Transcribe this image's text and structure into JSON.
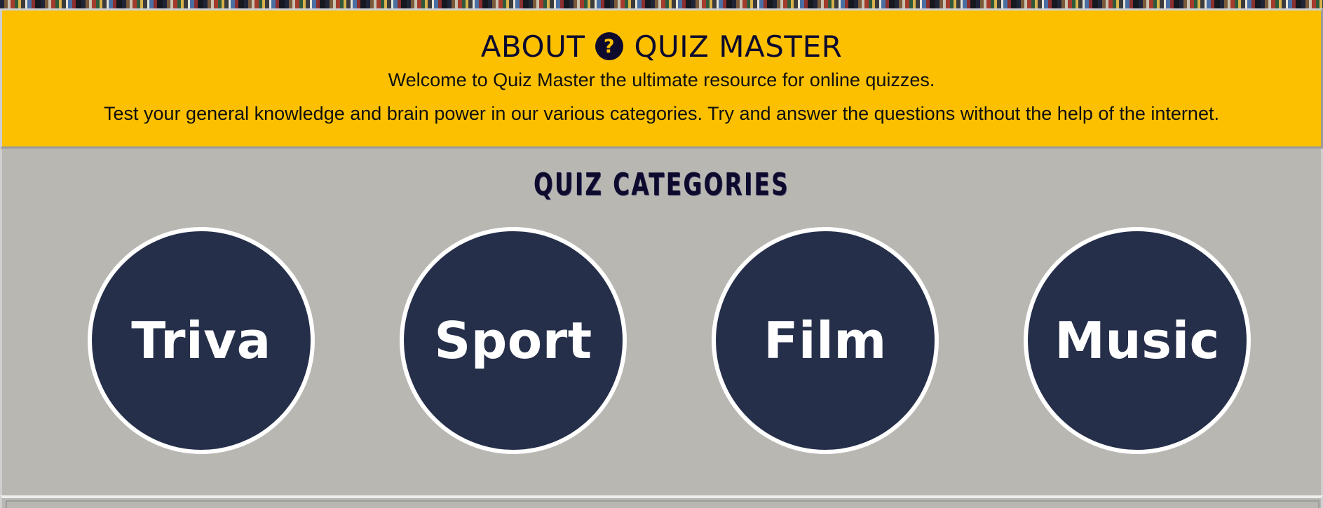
{
  "about": {
    "title_prefix": "ABOUT",
    "title_suffix": "QUIZ MASTER",
    "title_icon": "question-circle-icon",
    "welcome_text": "Welcome to Quiz Master the ultimate resource for online quizzes.",
    "description_text": "Test your general knowledge and brain power in our various categories. Try and answer the questions without the help of the internet."
  },
  "categories": {
    "heading": "QUIZ CATEGORIES",
    "items": [
      {
        "label": "Triva"
      },
      {
        "label": "Sport"
      },
      {
        "label": "Film"
      },
      {
        "label": "Music"
      }
    ]
  },
  "colors": {
    "about_background": "#fdc000",
    "categories_background": "#b8b7b2",
    "category_circle": "#262f4a",
    "category_border": "#ffffff",
    "heading_text": "#0d0a2e"
  }
}
